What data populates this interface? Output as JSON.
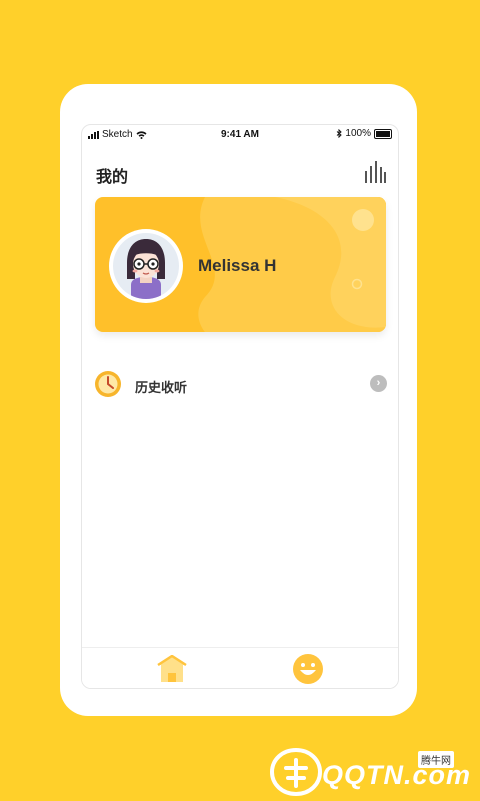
{
  "status_bar": {
    "carrier": "Sketch",
    "time": "9:41 AM",
    "battery": "100%"
  },
  "header": {
    "title": "我的"
  },
  "profile": {
    "name": "Melissa H"
  },
  "menu": {
    "items": [
      {
        "label": "历史收听",
        "icon": "clock-icon"
      }
    ]
  },
  "tabbar": {
    "items": [
      {
        "name": "home",
        "icon": "house-icon"
      },
      {
        "name": "me",
        "icon": "smile-icon",
        "active": true
      }
    ]
  },
  "watermark": {
    "brand": "QQTN.com",
    "badge": "腾牛网"
  },
  "colors": {
    "background": "#FFD02A",
    "card": "#FFC02A",
    "accent": "#F7B52C"
  }
}
